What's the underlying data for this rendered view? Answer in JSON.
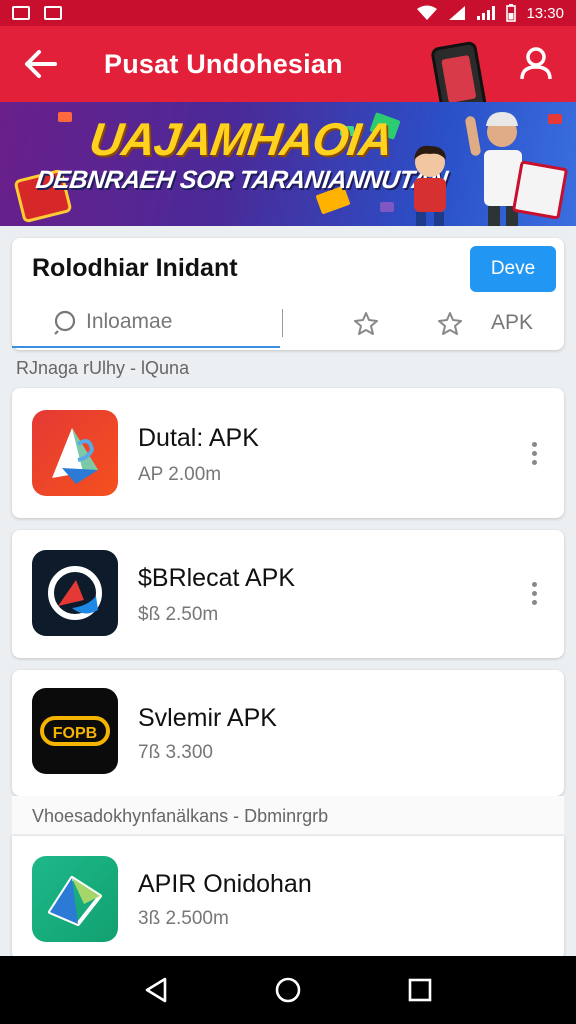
{
  "status_bar": {
    "time": "13:30"
  },
  "app_bar": {
    "title": "Pusat Undohesian"
  },
  "banner": {
    "headline": "UAJAMHAOIA",
    "subline": "DEBNRAEH SOR TARANIANNUTAN"
  },
  "search_card": {
    "title": "Rolodhiar Inidant",
    "button_label": "Deve",
    "search_placeholder": "Inloamae",
    "apk_tab": "APK"
  },
  "sections": [
    "RJnaga rUlhy - lQuna",
    "Vhoesadokhynfanälkans - Dbminrgrb"
  ],
  "apps": [
    {
      "name": "Dutal: APK",
      "size": "AP 2.00m"
    },
    {
      "name": "$BRlecat APK",
      "size": "$ß 2.50m"
    },
    {
      "name": "Svlemir APK",
      "size": "7ß 3.300"
    },
    {
      "name": "APIR Onidohan",
      "size": "3ß 2.500m"
    }
  ],
  "icon_text": {
    "app3": "FOPB"
  },
  "colors": {
    "header": "#e3203a",
    "status": "#c8102e",
    "accent": "#2196f3",
    "banner_yellow": "#ffd21f"
  }
}
